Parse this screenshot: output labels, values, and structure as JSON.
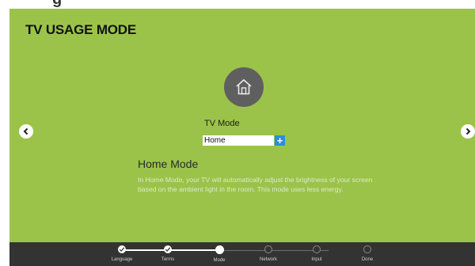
{
  "header": {
    "title": "TV USAGE MODE",
    "partial_heading": "g"
  },
  "tv_mode": {
    "label": "TV Mode",
    "selected": "Home",
    "add_symbol": "+"
  },
  "description": {
    "title": "Home Mode",
    "text": "In Home Mode, your TV will automatically adjust the brightness of your screen based on the ambient light in the room. This mode uses less energy."
  },
  "navigation": {
    "prev_icon": "chevron-left-icon",
    "next_icon": "chevron-right-icon"
  },
  "steps": [
    {
      "label": "Language",
      "state": "done"
    },
    {
      "label": "Terms",
      "state": "done"
    },
    {
      "label": "Mode",
      "state": "current"
    },
    {
      "label": "Network",
      "state": "todo"
    },
    {
      "label": "Input",
      "state": "todo"
    },
    {
      "label": "Done",
      "state": "todo"
    }
  ],
  "colors": {
    "background": "#9bc34a",
    "bottom_bar": "#333333",
    "icon_circle": "#5f5f5f",
    "accent": "#2a8ee0"
  }
}
